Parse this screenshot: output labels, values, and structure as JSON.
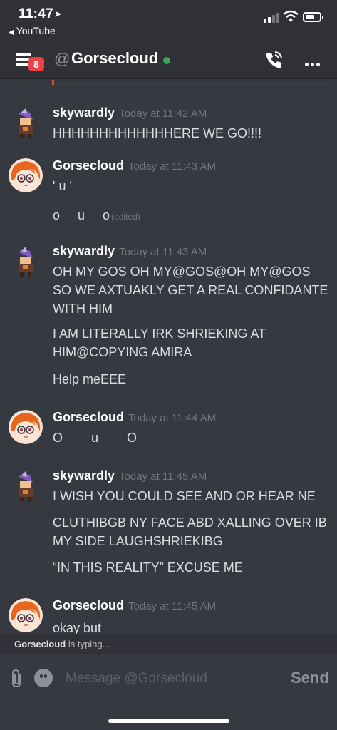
{
  "status_bar": {
    "time": "11:47",
    "back_app": "YouTube"
  },
  "header": {
    "badge_count": "8",
    "at_symbol": "@",
    "channel_name": "Gorsecloud"
  },
  "messages": [
    {
      "author": "skywardly",
      "timestamp": "Today at 11:42 AM",
      "avatar": "skywardly-avatar",
      "lines": [
        "HHHHHHHHHHHHHERE WE GO!!!!"
      ]
    },
    {
      "author": "Gorsecloud",
      "timestamp": "Today at 11:43 AM",
      "avatar": "gorsecloud-avatar",
      "lines": [
        "' u '",
        "o     u     o"
      ],
      "edited": "(edited)"
    },
    {
      "author": "skywardly",
      "timestamp": "Today at 11:43 AM",
      "avatar": "skywardly-avatar",
      "lines": [
        "OH MY GOS OH MY@GOS@OH MY@GOS SO WE AXTUAKLY GET A REAL CONFIDANTE WITH HIM",
        "I AM LITERALLY IRK SHRIEKING AT HIM@COPYING AMIRA",
        "Help meEEE"
      ]
    },
    {
      "author": "Gorsecloud",
      "timestamp": "Today at 11:44 AM",
      "avatar": "gorsecloud-avatar",
      "lines": [
        "O        u        O"
      ]
    },
    {
      "author": "skywardly",
      "timestamp": "Today at 11:45 AM",
      "avatar": "skywardly-avatar",
      "lines": [
        "I WISH YOU COULD SEE AND OR HEAR NE",
        "CLUTHIBGB NY FACE ABD XALLING OVER IB MY SIDE LAUGHSHRIEKIBG",
        "“IN THIS REALITY” EXCUSE ME"
      ]
    },
    {
      "author": "Gorsecloud",
      "timestamp": "Today at 11:45 AM",
      "avatar": "gorsecloud-avatar",
      "lines": [
        "okay but"
      ]
    }
  ],
  "typing": {
    "user": "Gorsecloud",
    "text": "is typing..."
  },
  "composer": {
    "placeholder": "Message @Gorsecloud",
    "send_label": "Send"
  },
  "icons": [
    "menu-icon",
    "call-icon",
    "more-icon",
    "attach-icon",
    "emoji-icon"
  ],
  "colors": {
    "background": "#36393f",
    "header": "#2f3136",
    "badge": "#ed4245",
    "online": "#3ba55d",
    "timestamp": "#72767d"
  }
}
